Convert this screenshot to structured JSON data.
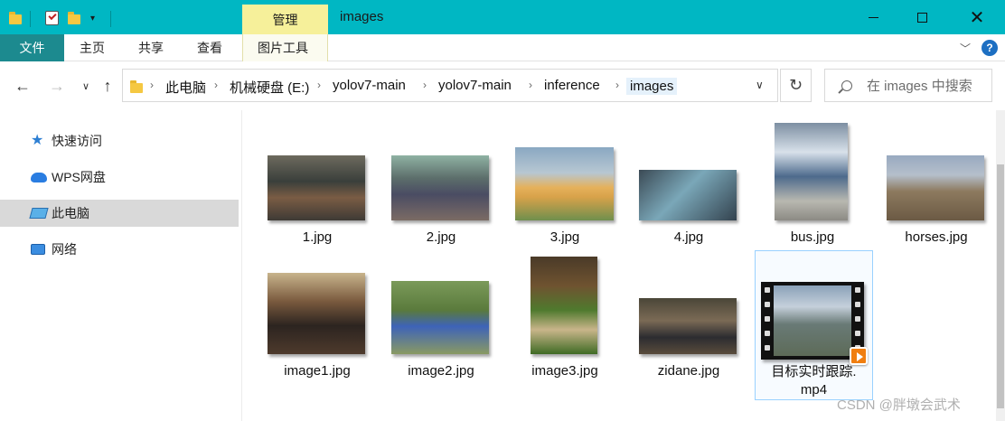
{
  "titlebar": {
    "context_tab": "管理",
    "title": "images"
  },
  "ribbon": {
    "tabs": [
      "文件",
      "主页",
      "共享",
      "查看",
      "图片工具"
    ]
  },
  "address": {
    "crumbs": [
      "此电脑",
      "机械硬盘 (E:)",
      "yolov7-main",
      "yolov7-main",
      "inference",
      "images"
    ]
  },
  "search": {
    "placeholder": "在 images 中搜索"
  },
  "nav": {
    "items": [
      {
        "label": "快速访问",
        "icon": "star-icon"
      },
      {
        "label": "WPS网盘",
        "icon": "cloud-icon"
      },
      {
        "label": "此电脑",
        "icon": "pc-icon"
      },
      {
        "label": "网络",
        "icon": "network-icon"
      }
    ]
  },
  "files": [
    {
      "name": "1.jpg"
    },
    {
      "name": "2.jpg"
    },
    {
      "name": "3.jpg"
    },
    {
      "name": "4.jpg"
    },
    {
      "name": "bus.jpg"
    },
    {
      "name": "horses.jpg"
    },
    {
      "name": "image1.jpg"
    },
    {
      "name": "image2.jpg"
    },
    {
      "name": "image3.jpg"
    },
    {
      "name": "zidane.jpg"
    },
    {
      "name_line1": "目标实时跟踪.",
      "name_line2": "mp4"
    }
  ],
  "watermark": "CSDN @胖墩会武术",
  "colors": {
    "titlebar": "#00b7c3",
    "file_tab": "#1c8a8f",
    "context_tab": "#f6f09a",
    "selection": "#d9d9d9"
  }
}
